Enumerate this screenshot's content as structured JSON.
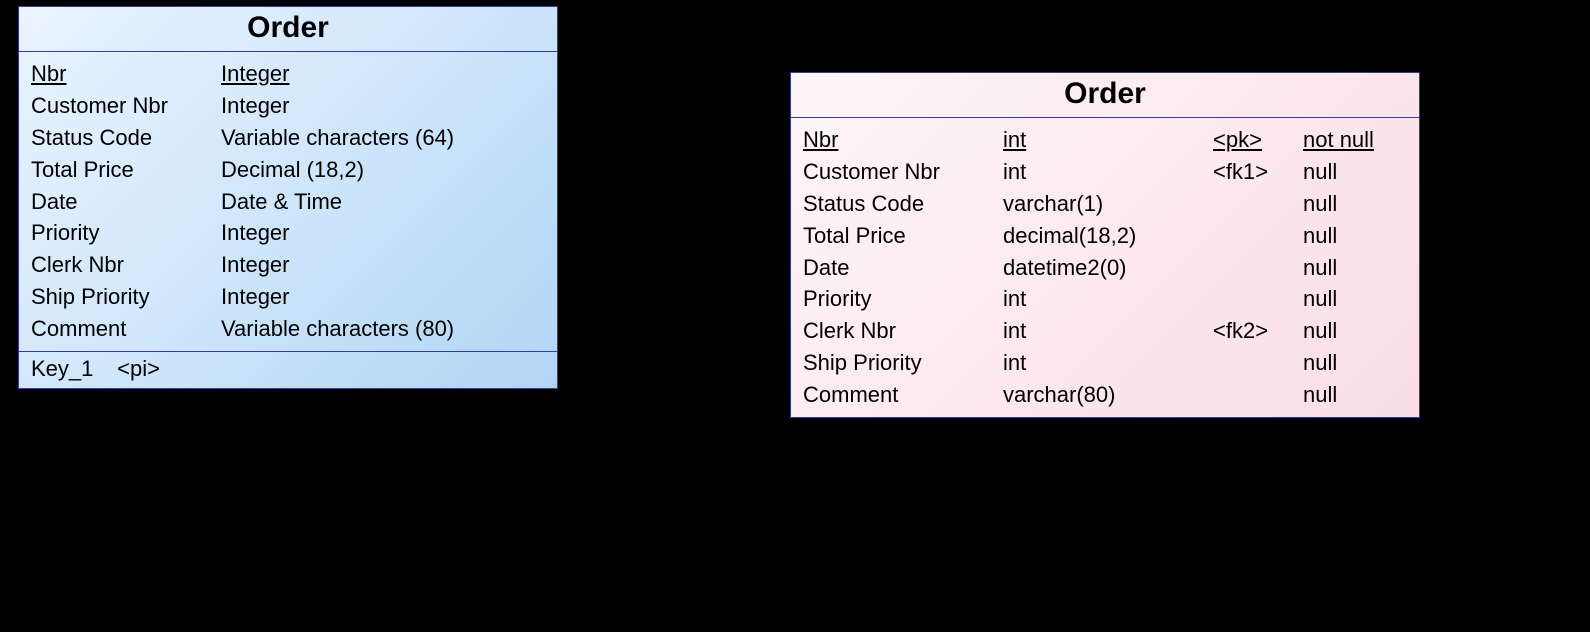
{
  "left": {
    "title": "Order",
    "rows": [
      {
        "name": "Nbr",
        "type": "Integer",
        "u": true
      },
      {
        "name": "Customer Nbr",
        "type": "Integer",
        "u": false
      },
      {
        "name": "Status Code",
        "type": "Variable characters (64)",
        "u": false
      },
      {
        "name": "Total Price",
        "type": "Decimal (18,2)",
        "u": false
      },
      {
        "name": "Date",
        "type": "Date & Time",
        "u": false
      },
      {
        "name": "Priority",
        "type": "Integer",
        "u": false
      },
      {
        "name": "Clerk Nbr",
        "type": "Integer",
        "u": false
      },
      {
        "name": "Ship Priority",
        "type": "Integer",
        "u": false
      },
      {
        "name": "Comment",
        "type": "Variable characters (80)",
        "u": false
      }
    ],
    "key": {
      "name": "Key_1",
      "tag": "<pi>"
    }
  },
  "right": {
    "title": "Order",
    "rows": [
      {
        "name": "Nbr",
        "type": "int",
        "key": "<pk>",
        "null": "not null",
        "u": true
      },
      {
        "name": "Customer Nbr",
        "type": "int",
        "key": "<fk1>",
        "null": "null",
        "u": false
      },
      {
        "name": "Status Code",
        "type": "varchar(1)",
        "key": "",
        "null": "null",
        "u": false
      },
      {
        "name": "Total Price",
        "type": "decimal(18,2)",
        "key": "",
        "null": "null",
        "u": false
      },
      {
        "name": "Date",
        "type": "datetime2(0)",
        "key": "",
        "null": "null",
        "u": false
      },
      {
        "name": "Priority",
        "type": "int",
        "key": "",
        "null": "null",
        "u": false
      },
      {
        "name": "Clerk Nbr",
        "type": "int",
        "key": "<fk2>",
        "null": "null",
        "u": false
      },
      {
        "name": "Ship Priority",
        "type": "int",
        "key": "",
        "null": "null",
        "u": false
      },
      {
        "name": "Comment",
        "type": "varchar(80)",
        "key": "",
        "null": "null",
        "u": false
      }
    ]
  }
}
